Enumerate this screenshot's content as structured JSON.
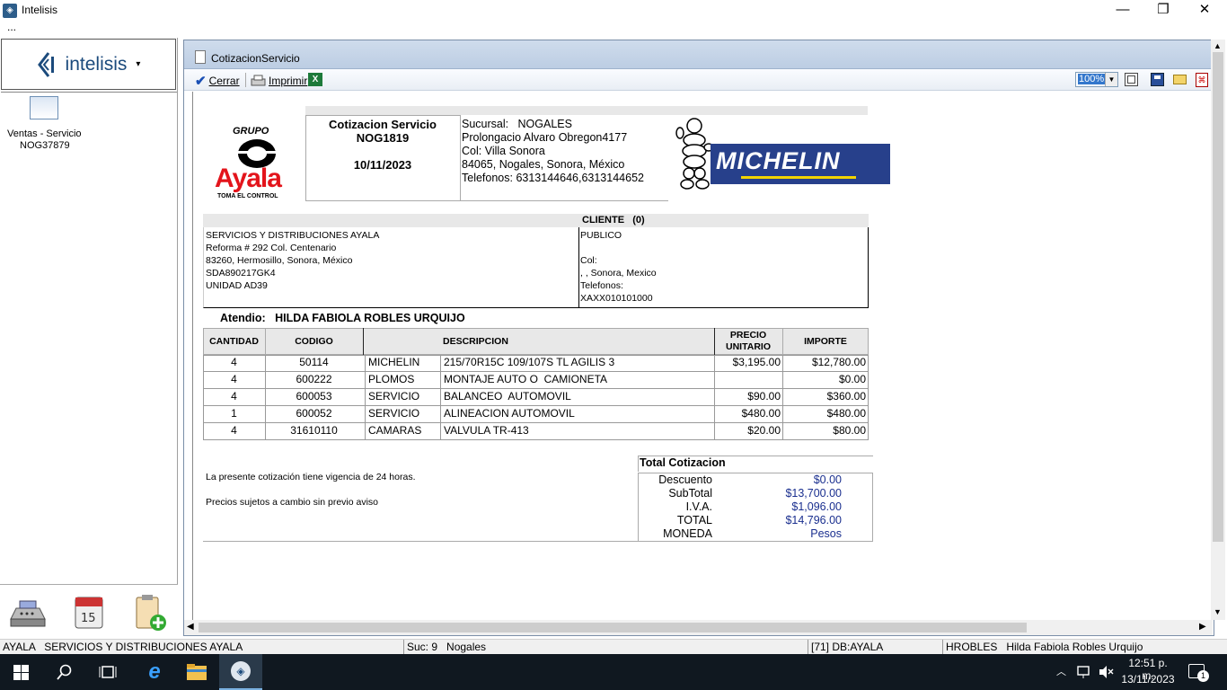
{
  "window": {
    "title": "Intelisis",
    "menu": "...",
    "min": "—",
    "max": "❐",
    "close": "✕"
  },
  "left": {
    "logo": "intelisis",
    "logo_caret": "▾",
    "task": {
      "line1": "Ventas - Servicio",
      "line2": "NOG37879"
    }
  },
  "doc": {
    "title": "CotizacionServicio"
  },
  "toolbar": {
    "cerrar": "Cerrar",
    "imprimir": "Imprimir",
    "zoom": "100%"
  },
  "report": {
    "company_logo": {
      "line1": "GRUPO",
      "line2": "Ayala",
      "line3": "TOMA EL CONTROL"
    },
    "brand_logo": "MICHELIN",
    "header": {
      "title": "Cotizacion Servicio",
      "number": "NOG1819",
      "date": "10/11/2023"
    },
    "branch": {
      "sucursal_label": "Sucursal:",
      "sucursal": "NOGALES",
      "line2": "Prolongacio Alvaro Obregon4177",
      "line3": "Col: Villa Sonora",
      "line4": "84065, Nogales, Sonora, México",
      "line5": "Telefonos: 6313144646,6313144652"
    },
    "company": {
      "line1": "SERVICIOS Y DISTRIBUCIONES AYALA",
      "line2": "Reforma # 292 Col. Centenario",
      "line3": "83260, Hermosillo, Sonora, México",
      "line4": "SDA890217GK4",
      "line5": "UNIDAD AD39"
    },
    "cliente": {
      "header": "CLIENTE   (0)",
      "line1": "PUBLICO",
      "line2": "",
      "line3": "Col:",
      "line4": ", , Sonora, Mexico",
      "line5": "Telefonos:",
      "line6": "XAXX010101000"
    },
    "atendio": {
      "label": "Atendio:",
      "name": "HILDA FABIOLA ROBLES URQUIJO"
    },
    "table": {
      "headers": {
        "cantidad": "CANTIDAD",
        "codigo": "CODIGO",
        "descripcion": "DESCRIPCION",
        "precio1": "PRECIO",
        "precio2": "UNITARIO",
        "importe": "IMPORTE"
      },
      "rows": [
        {
          "cantidad": "4",
          "codigo": "50114",
          "tipo": "MICHELIN",
          "desc": "215/70R15C 109/107S TL AGILIS 3",
          "precio": "$3,195.00",
          "importe": "$12,780.00"
        },
        {
          "cantidad": "4",
          "codigo": "600222",
          "tipo": "PLOMOS",
          "desc": "MONTAJE AUTO O  CAMIONETA",
          "precio": "",
          "importe": "$0.00"
        },
        {
          "cantidad": "4",
          "codigo": "600053",
          "tipo": "SERVICIO",
          "desc": "BALANCEO  AUTOMOVIL",
          "precio": "$90.00",
          "importe": "$360.00"
        },
        {
          "cantidad": "1",
          "codigo": "600052",
          "tipo": "SERVICIO",
          "desc": "ALINEACION AUTOMOVIL",
          "precio": "$480.00",
          "importe": "$480.00"
        },
        {
          "cantidad": "4",
          "codigo": "31610110",
          "tipo": "CAMARAS",
          "desc": "VALVULA TR-413",
          "precio": "$20.00",
          "importe": "$80.00"
        }
      ]
    },
    "notes": {
      "line1": "La presente cotización tiene vigencia de 24 horas.",
      "line2": "Precios sujetos a cambio sin previo aviso"
    },
    "totals": {
      "title": "Total Cotizacion",
      "rows": [
        {
          "label": "Descuento",
          "value": "$0.00"
        },
        {
          "label": "SubTotal",
          "value": "$13,700.00"
        },
        {
          "label": "I.V.A.",
          "value": "$1,096.00"
        },
        {
          "label": "TOTAL",
          "value": "$14,796.00"
        },
        {
          "label": "MONEDA",
          "value": "Pesos"
        }
      ]
    }
  },
  "status": {
    "empresa": "AYALA   SERVICIOS Y DISTRIBUCIONES AYALA",
    "suc": "Suc: 9   Nogales",
    "db": "[71] DB:AYALA",
    "user": "HROBLES   Hilda Fabiola Robles Urquijo"
  },
  "taskbar": {
    "time": "12:51 p. m.",
    "date": "13/11/2023",
    "notif": "1"
  },
  "colors": {
    "accent": "#1b4a7c",
    "michelin_blue": "#27408b",
    "ayala_red": "#e3141b",
    "totals_blue": "#1a2f8f"
  }
}
